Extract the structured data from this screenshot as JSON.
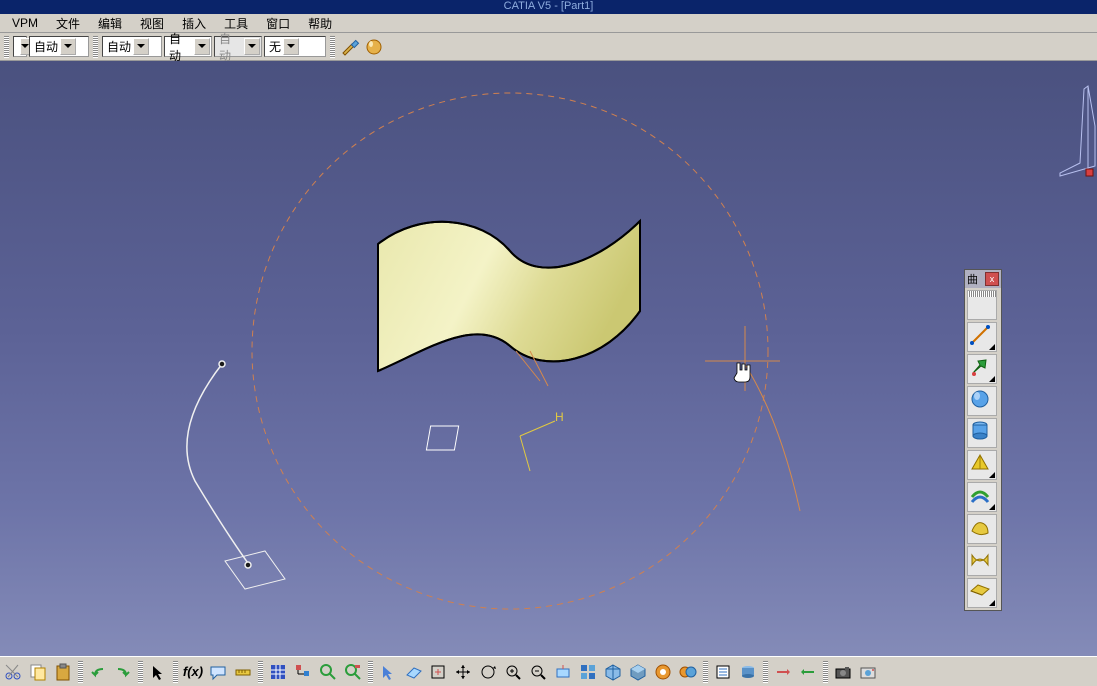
{
  "title": "CATIA V5 - [Part1]",
  "menu": {
    "vpm": "VPM",
    "file": "文件",
    "edit": "编辑",
    "view": "视图",
    "insert": "插入",
    "tools": "工具",
    "window": "窗口",
    "help": "帮助"
  },
  "toolbar": {
    "combo1": "",
    "combo2": "自动",
    "combo3": "自动",
    "combo4": "自动",
    "combo5": "自动",
    "combo6": "无"
  },
  "panel": {
    "title": "曲",
    "close": "x",
    "tools": {
      "point": "point-icon",
      "line": "line-icon",
      "plane": "plane-icon",
      "sphere": "sphere-icon",
      "cylinder": "cylinder-icon",
      "sweep": "sweep-icon",
      "offset": "offset-icon",
      "fill": "fill-icon",
      "blend": "blend-icon",
      "multisection": "multisection-icon"
    }
  },
  "bottombar": {
    "cut": "cut-icon",
    "copy": "copy-icon",
    "paste": "paste-icon",
    "undo": "undo-icon",
    "redo": "redo-icon",
    "arrow": "select-arrow-icon",
    "formula": "f(x)",
    "chat": "chat-icon",
    "measure": "measure-icon",
    "grid": "grid-icon",
    "tree": "tree-icon",
    "mag": "mag-icon",
    "mag2": "mag2-icon",
    "arrow2": "arrow2-icon",
    "plane2": "plane-icon",
    "fit": "fit-icon",
    "pan": "pan-icon",
    "rotate": "rotate-icon",
    "zoomin": "zoom-in-icon",
    "zoomout": "zoom-out-icon",
    "normal": "normal-view-icon",
    "multi": "multi-view-icon",
    "iso": "iso-view-icon",
    "shade": "shade-icon",
    "hide": "hide-icon",
    "swap": "swap-icon",
    "props": "props-icon",
    "cache": "cache-icon",
    "tog1": "toggle-icon",
    "tog2": "toggle2-icon",
    "camera": "camera-icon",
    "snap": "snapshot-icon"
  },
  "canvas": {
    "axis_label": "H",
    "cursor": "hand-cursor"
  },
  "colors": {
    "surface_fill": "#e9e8ad",
    "surface_highlight": "#d2cf6d",
    "circle": "#d0804f",
    "curve_orange": "#d5894b",
    "wire_white": "#f0f0f0"
  }
}
